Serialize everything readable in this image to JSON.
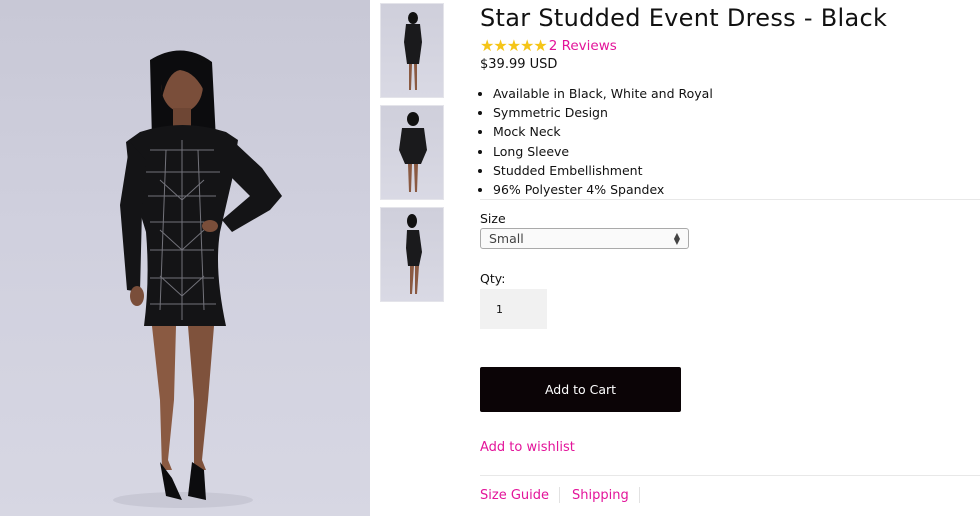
{
  "product": {
    "title": "Star Studded Event Dress - Black",
    "rating_stars": "★★★★★",
    "reviews": "2 Reviews",
    "price": "$39.99 USD",
    "features": [
      "Available in Black, White and Royal",
      "Symmetric Design",
      "Mock Neck",
      "Long Sleeve",
      "Studded Embellishment",
      "96% Polyester 4% Spandex"
    ]
  },
  "size": {
    "label": "Size",
    "selected": "Small"
  },
  "qty": {
    "label": "Qty:",
    "value": "1"
  },
  "actions": {
    "add_to_cart": "Add to Cart",
    "wishlist": "Add to wishlist",
    "size_guide": "Size Guide",
    "shipping": "Shipping"
  },
  "colors": {
    "accent": "#e3149a",
    "star": "#f5c518",
    "button": "#0b0406"
  },
  "icons": {
    "star": "star-icon",
    "select_arrows": "select-arrows-icon"
  }
}
